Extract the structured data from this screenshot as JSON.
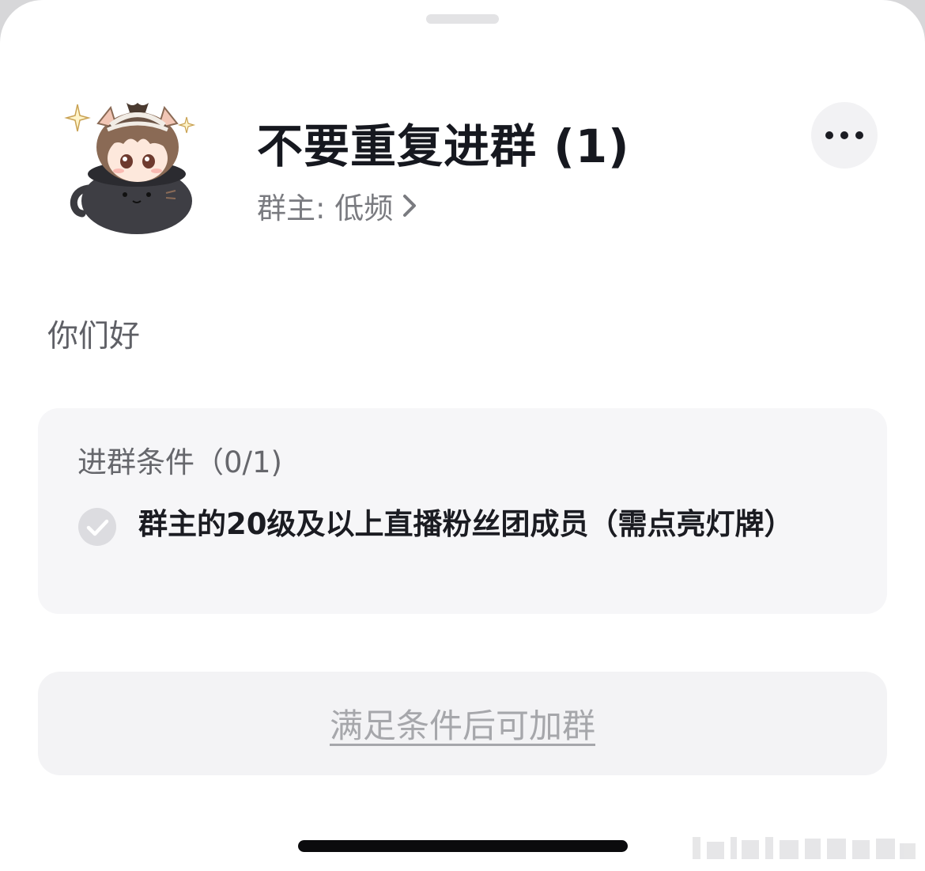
{
  "header": {
    "group_name": "不要重复进群 (1)",
    "owner_label": "群主: 低频",
    "more_icon": "more-horizontal-icon",
    "avatar": "cartoon-avatar"
  },
  "description": "你们好",
  "conditions": {
    "title": "进群条件（0/1)",
    "items": [
      {
        "text": "群主的20级及以上直播粉丝团成员（需点亮灯牌）",
        "met": false,
        "icon": "check-circle-icon"
      }
    ]
  },
  "actions": {
    "join_label": "满足条件后可加群"
  },
  "colors": {
    "title": "#16181f",
    "muted_text": "#7a7b80",
    "card_bg": "#f6f6f8",
    "disabled_button_text": "#a6a7ab"
  }
}
